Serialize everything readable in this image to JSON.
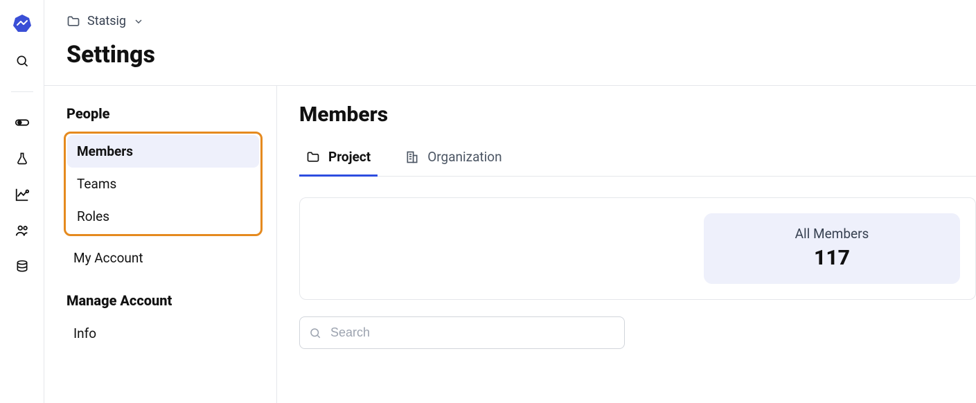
{
  "breadcrumb": {
    "label": "Statsig"
  },
  "page_title": "Settings",
  "sidebar": {
    "sections": [
      {
        "title": "People",
        "items": [
          {
            "label": "Members",
            "active": true
          },
          {
            "label": "Teams"
          },
          {
            "label": "Roles"
          }
        ],
        "extra_items": [
          {
            "label": "My Account"
          }
        ]
      },
      {
        "title": "Manage Account",
        "items": [
          {
            "label": "Info"
          }
        ]
      }
    ]
  },
  "main": {
    "title": "Members",
    "tabs": [
      {
        "label": "Project",
        "active": true
      },
      {
        "label": "Organization"
      }
    ],
    "summary": {
      "label": "All Members",
      "count": "117"
    },
    "search_placeholder": "Search"
  }
}
